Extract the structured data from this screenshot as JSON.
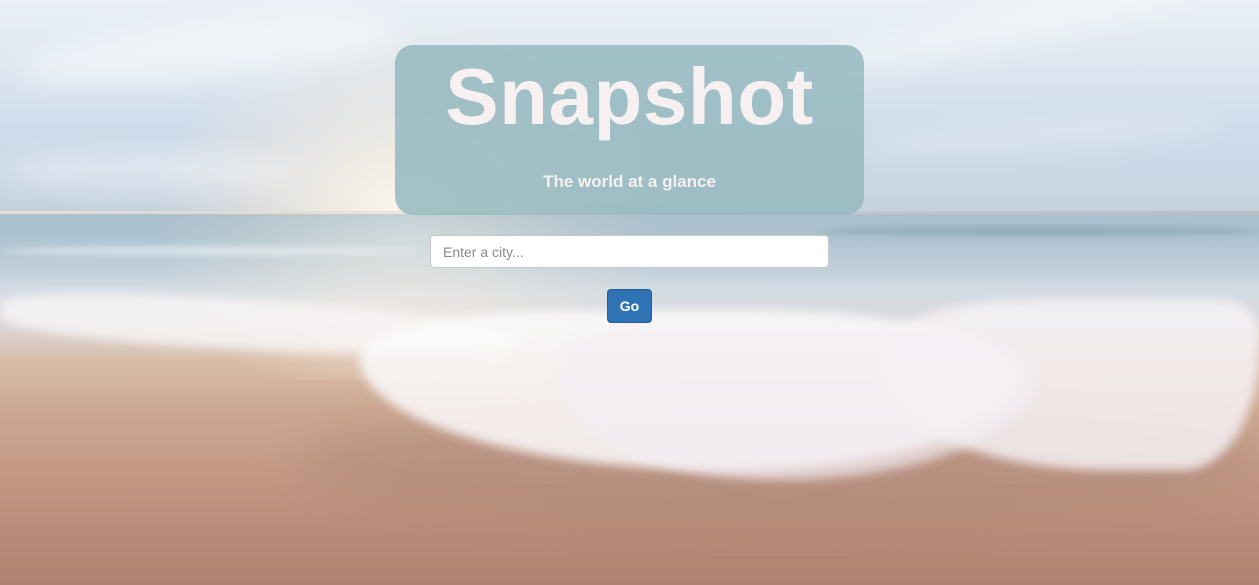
{
  "app": {
    "title": "Snapshot",
    "tagline": "The world at a glance"
  },
  "search": {
    "value": "",
    "placeholder": "Enter a city...",
    "button_label": "Go"
  },
  "colors": {
    "header_card": "#97b9c0",
    "title_text": "#f6f0f0",
    "button": "#2f73b5",
    "input_border": "#c7c7c7"
  },
  "background": {
    "subject": "beach-at-sunrise-photo"
  }
}
